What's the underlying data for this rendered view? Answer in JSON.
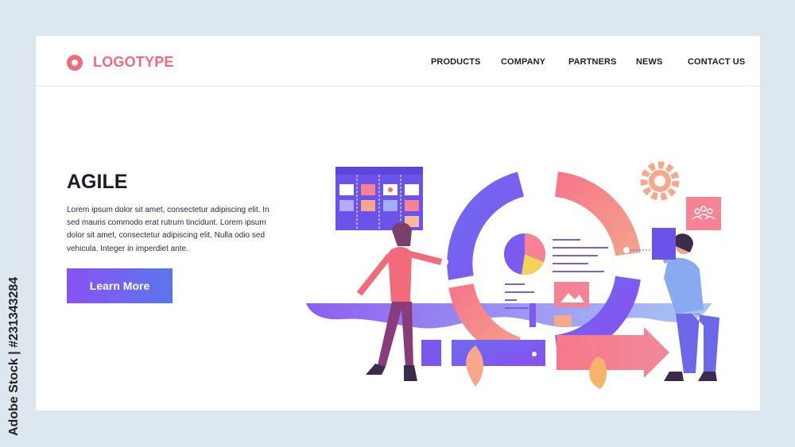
{
  "brand": {
    "name": "LOGOTYPE",
    "color": "#f26b7a"
  },
  "nav": {
    "items": [
      "PRODUCTS",
      "COMPANY",
      "PARTNERS",
      "NEWS",
      "CONTACT US"
    ]
  },
  "hero": {
    "title": "AGILE",
    "body": "Lorem ipsum dolor sit amet, consectetur adipiscing elit. In sed mauris commodo erat rutrum tincidunt. Lorem ipsum dolor sit amet, consectetur adipiscing elit. Nulla  odio sed vehicula. Integer in imperdiet ante.",
    "cta_label": "Learn More"
  },
  "watermark": {
    "side_text": "Adobe Stock | #231343284"
  },
  "colors": {
    "accent_pink": "#f26b7a",
    "accent_purple": "#7c5cf0",
    "button_gradient_start": "#8a52f3",
    "button_gradient_end": "#5a76ec",
    "background": "#dde7ef"
  }
}
